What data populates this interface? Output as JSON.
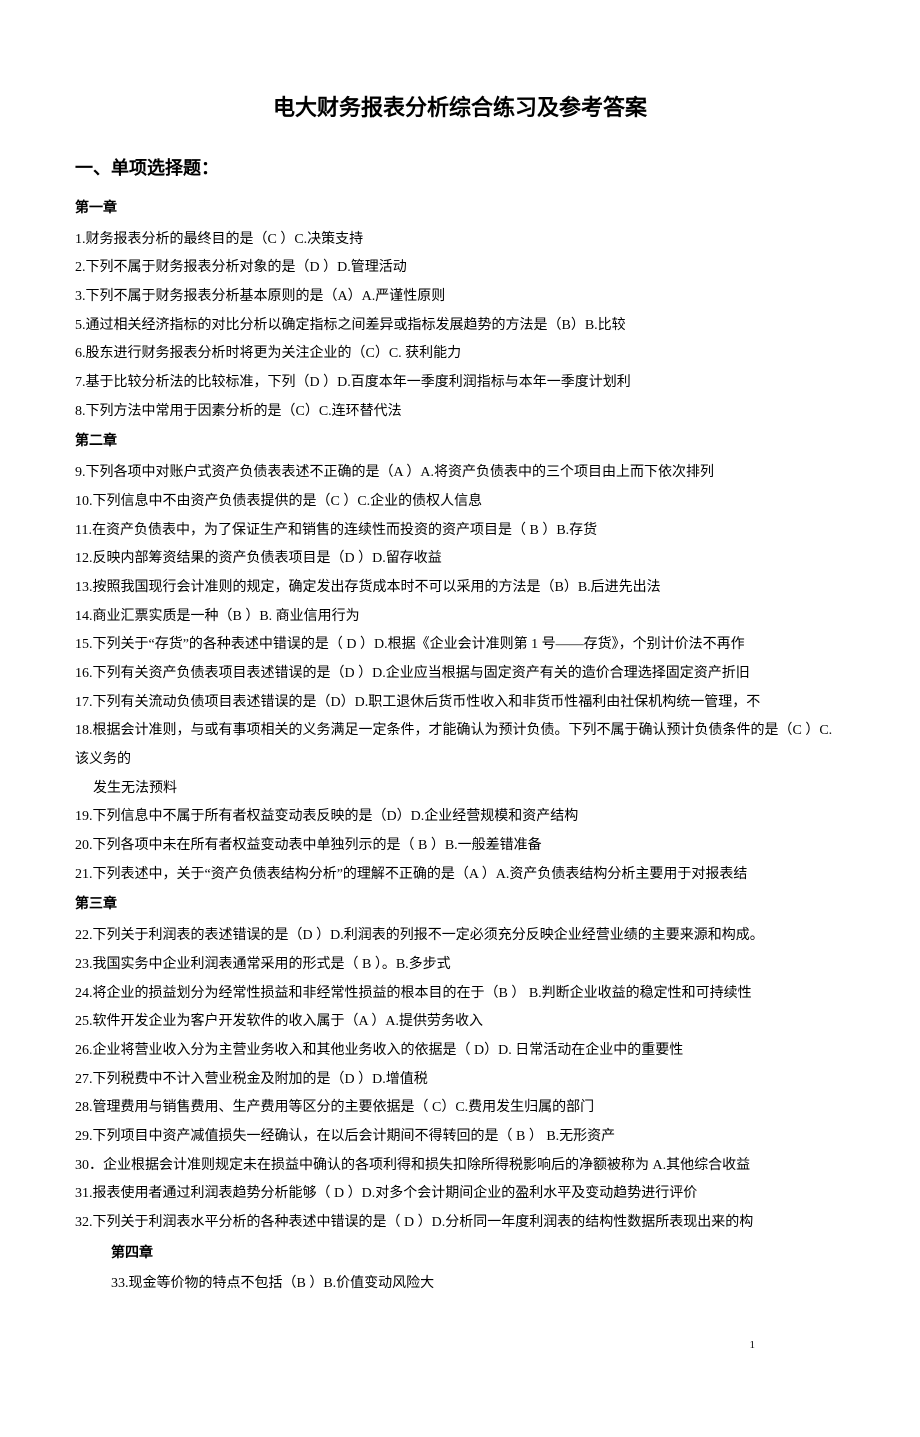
{
  "title": "电大财务报表分析综合练习及参考答案",
  "section": "一、单项选择题：",
  "ch1": "第一章",
  "q1": "1.财务报表分析的最终目的是（C ）C.决策支持",
  "q2": "2.下列不属于财务报表分析对象的是（D  ）D.管理活动",
  "q3": "3.下列不属于财务报表分析基本原则的是（A）A.严谨性原则",
  "q5": "5.通过相关经济指标的对比分析以确定指标之间差异或指标发展趋势的方法是（B）B.比较",
  "q6": "6.股东进行财务报表分析时将更为关注企业的（C）C. 获利能力",
  "q7": "7.基于比较分析法的比较标准，下列（D ）D.百度本年一季度利润指标与本年一季度计划利",
  "q8": "8.下列方法中常用于因素分析的是（C）C.连环替代法",
  "ch2": "第二章",
  "q9": "9.下列各项中对账户式资产负债表表述不正确的是（A ）A.将资产负债表中的三个项目由上而下依次排列",
  "q10": "10.下列信息中不由资产负债表提供的是（C ）C.企业的债权人信息",
  "q11": "11.在资产负债表中，为了保证生产和销售的连续性而投资的资产项目是（ B ）B.存货",
  "q12": "12.反映内部筹资结果的资产负债表项目是（D ）D.留存收益",
  "q13": "13.按照我国现行会计准则的规定，确定发出存货成本时不可以采用的方法是（B）B.后进先出法",
  "q14": "14.商业汇票实质是一种（B ）B. 商业信用行为",
  "q15": "15.下列关于“存货”的各种表述中错误的是（ D ）D.根据《企业会计准则第 1 号——存货》，个别计价法不再作",
  "q16": "16.下列有关资产负债表项目表述错误的是（D ）D.企业应当根据与固定资产有关的造价合理选择固定资产折旧",
  "q17": "17.下列有关流动负债项目表述错误的是（D）D.职工退休后货币性收入和非货币性福利由社保机构统一管理，不",
  "q18a": "18.根据会计准则，与或有事项相关的义务满足一定条件，才能确认为预计负债。下列不属于确认预计负债条件的是（C ）C.该义务的",
  "q18b": "发生无法预料",
  "q19": "19.下列信息中不属于所有者权益变动表反映的是（D）D.企业经营规模和资产结构",
  "q20": "20.下列各项中未在所有者权益变动表中单独列示的是（ B ）B.一般差错准备",
  "q21": "21.下列表述中，关于“资产负债表结构分析”的理解不正确的是（A  ）A.资产负债表结构分析主要用于对报表结",
  "ch3": "第三章",
  "q22": "22.下列关于利润表的表述错误的是（D  ）D.利润表的列报不一定必须充分反映企业经营业绩的主要来源和构成。",
  "q23": "23.我国实务中企业利润表通常采用的形式是（ B ）。B.多步式",
  "q24": "24.将企业的损益划分为经常性损益和非经常性损益的根本目的在于（B  ） B.判断企业收益的稳定性和可持续性",
  "q25": "25.软件开发企业为客户开发软件的收入属于（A  ）A.提供劳务收入",
  "q26": "26.企业将营业收入分为主营业务收入和其他业务收入的依据是（ D）D. 日常活动在企业中的重要性",
  "q27": "27.下列税费中不计入营业税金及附加的是（D ）D.增值税",
  "q28": "28.管理费用与销售费用、生产费用等区分的主要依据是（ C）C.费用发生归属的部门",
  "q29": "29.下列项目中资产减值损失一经确认，在以后会计期间不得转回的是（ B ）  B.无形资产",
  "q30": "30．企业根据会计准则规定未在损益中确认的各项利得和损失扣除所得税影响后的净额被称为 A.其他综合收益",
  "q31": "31.报表使用者通过利润表趋势分析能够（ D ）D.对多个会计期间企业的盈利水平及变动趋势进行评价",
  "q32": "32.下列关于利润表水平分析的各种表述中错误的是（ D ）D.分析同一年度利润表的结构性数据所表现出来的构",
  "ch4": "第四章",
  "q33": "33.现金等价物的特点不包括（B  ）B.价值变动风险大",
  "pageNum": "1"
}
